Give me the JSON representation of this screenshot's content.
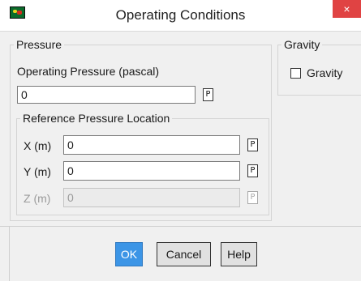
{
  "window": {
    "title": "Operating Conditions",
    "close_label": "×"
  },
  "pressure": {
    "legend": "Pressure",
    "operating_pressure_label": "Operating Pressure (pascal)",
    "operating_pressure_value": "0",
    "param_button": "P"
  },
  "reference_location": {
    "legend": "Reference Pressure Location",
    "x_label": "X (m)",
    "x_value": "0",
    "y_label": "Y (m)",
    "y_value": "0",
    "z_label": "Z (m)",
    "z_value": "0",
    "param_button": "P"
  },
  "gravity": {
    "legend": "Gravity",
    "checkbox_label": "Gravity",
    "checked": false
  },
  "buttons": {
    "ok": "OK",
    "cancel": "Cancel",
    "help": "Help"
  },
  "colors": {
    "ok_button": "#3c95e6",
    "close_button": "#e04343",
    "background": "#f0f0f0"
  }
}
